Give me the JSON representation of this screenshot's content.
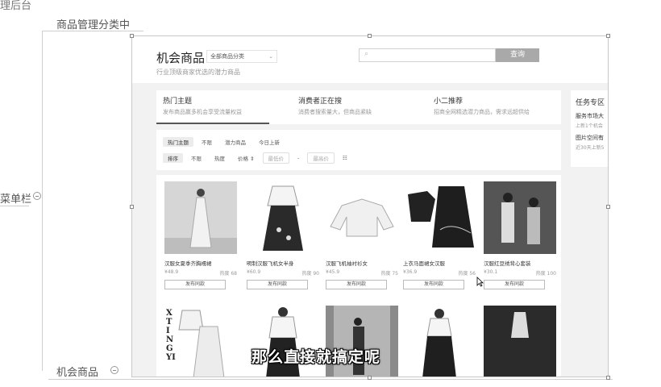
{
  "mindmap": {
    "top_node_partial": "理后台",
    "parent_node": "商品管理分类中",
    "left_node_partial": "菜单栏",
    "bottom_node": "机会商品"
  },
  "page": {
    "title": "机会商品",
    "category_select": "全部商品分类",
    "subtitle": "行业顶级商家优选的潜力商品",
    "search": {
      "placeholder": "",
      "button": "查询"
    }
  },
  "tabs": [
    {
      "title": "热门主题",
      "desc": "发布商品赢多机会享受流量权益"
    },
    {
      "title": "消费者正在搜",
      "desc": "消费者搜索量大，但商品紧缺"
    },
    {
      "title": "小二推荐",
      "desc": "招商全网精选潜力商品，需求远超供给"
    }
  ],
  "task_panel": {
    "title": "任务专区",
    "items": [
      {
        "title": "服务市场大",
        "sub": "上新1个机会"
      },
      {
        "title": "图片空间有",
        "sub": "近30天上新5"
      }
    ]
  },
  "filters": {
    "row1": [
      "热门主题",
      "不限",
      "潜力商品",
      "今日上新"
    ],
    "row2": [
      "排序",
      "不限",
      "热度",
      "价格 ⇕",
      "最低价",
      "-",
      "最高价",
      "☷"
    ]
  },
  "products": [
    {
      "name": "汉服女夏季齐胸襦裙",
      "price": "¥48.9",
      "heat": "热度 68",
      "button": "发布同款"
    },
    {
      "name": "明制汉服飞机女半身",
      "price": "¥60.9",
      "heat": "热度 90",
      "button": "发布同款"
    },
    {
      "name": "汉服飞机袖衬衫女",
      "price": "¥45.9",
      "heat": "热度 75",
      "button": "发布同款"
    },
    {
      "name": "上衣马面裙女汉服",
      "price": "¥36.9",
      "heat": "热度 56",
      "button": "发布同款"
    },
    {
      "name": "汉服红豆绣背心套装",
      "price": "¥30.1",
      "heat": "热度 100",
      "button": "发布同款"
    }
  ],
  "brand_text": "X TING YI",
  "caption": "那么直接就搞定呢"
}
